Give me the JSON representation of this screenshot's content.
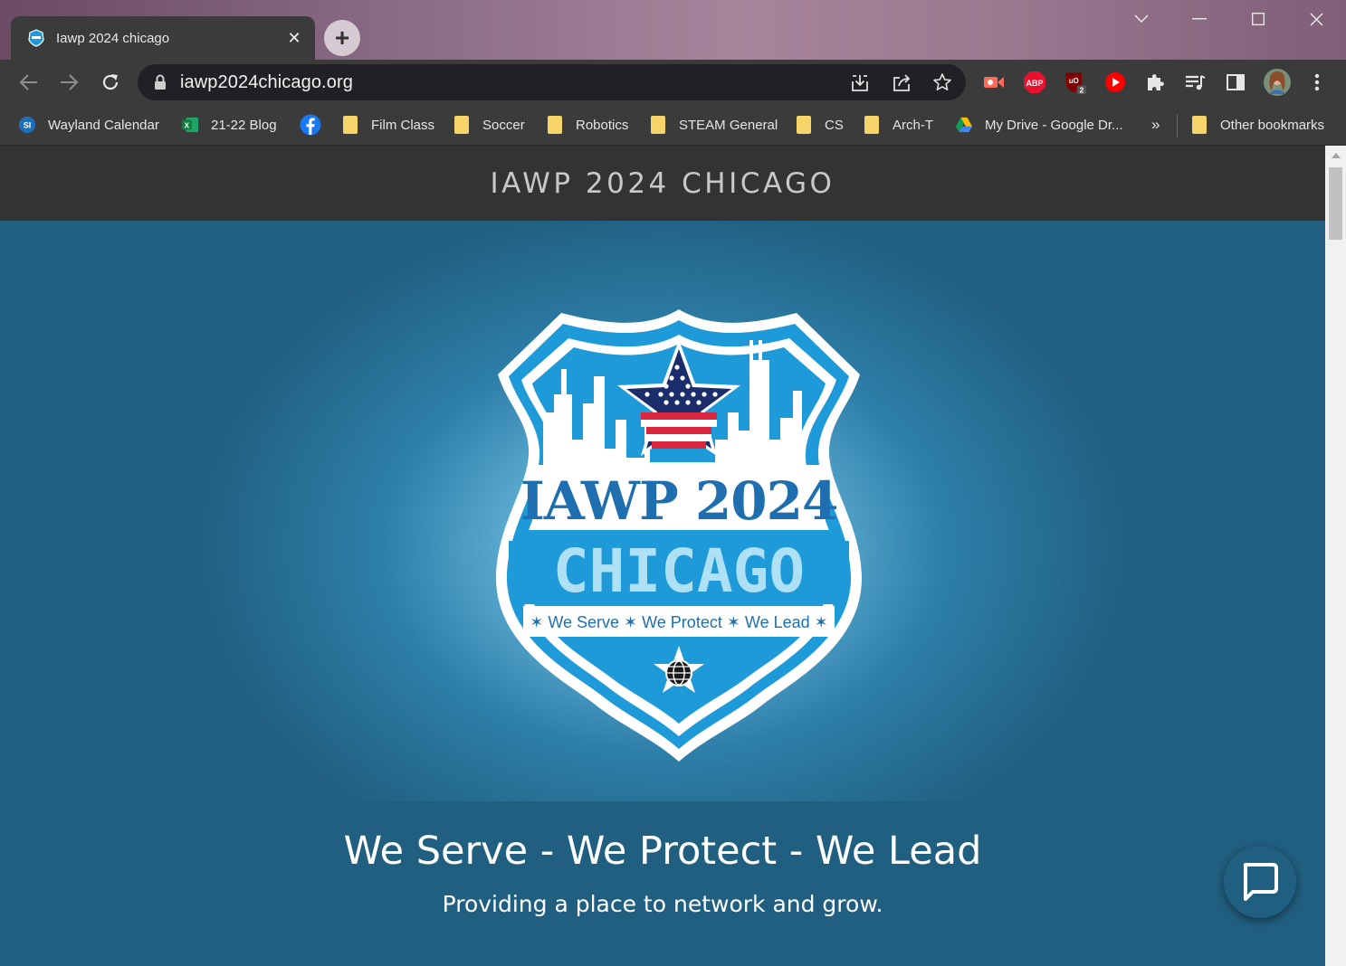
{
  "browser": {
    "tab": {
      "title": "Iawp 2024 chicago",
      "close_glyph": "✕"
    },
    "new_tab_glyph": "+",
    "window_controls": [
      "tab-search-icon",
      "minimize-icon",
      "maximize-icon",
      "close-icon"
    ],
    "address_bar": {
      "url": "iawp2024chicago.org"
    },
    "extensions": [
      {
        "name": "screencastify-icon",
        "color": "#ff5a4e"
      },
      {
        "name": "adblock-plus-icon",
        "label": "ABP",
        "color": "#e8112d"
      },
      {
        "name": "ublock-origin-icon",
        "label": "uO",
        "badge": "2",
        "color": "#800000"
      },
      {
        "name": "youtube-icon",
        "color": "#ff0000"
      },
      {
        "name": "extensions-puzzle-icon"
      },
      {
        "name": "reading-list-icon"
      },
      {
        "name": "side-panel-icon"
      },
      {
        "name": "profile-avatar"
      },
      {
        "name": "menu-kebab-icon"
      }
    ]
  },
  "bookmarks": {
    "items": [
      {
        "label": "Wayland Calendar",
        "icon": "wayland-si-icon"
      },
      {
        "label": "21-22 Blog",
        "icon": "excel-icon"
      },
      {
        "label": "",
        "icon": "facebook-icon"
      },
      {
        "label": "Film Class",
        "icon": "folder-icon"
      },
      {
        "label": "Soccer",
        "icon": "folder-icon"
      },
      {
        "label": "Robotics",
        "icon": "folder-icon"
      },
      {
        "label": "STEAM General",
        "icon": "folder-icon"
      },
      {
        "label": "CS",
        "icon": "folder-icon"
      },
      {
        "label": "Arch-T",
        "icon": "folder-icon"
      },
      {
        "label": "My Drive - Google Dr...",
        "icon": "google-drive-icon"
      }
    ],
    "overflow": "»",
    "other": "Other bookmarks"
  },
  "page": {
    "site_title": "IAWP 2024 CHICAGO",
    "logo": {
      "line1": "IAWP 2024",
      "line2": "CHICAGO",
      "motto": "✶ We Serve ✶ We Protect ✶ We Lead ✶"
    },
    "tagline": "We Serve - We Protect - We Lead",
    "subline": "Providing a place to network and grow.",
    "colors": {
      "header": "#333333",
      "background": "#215f80",
      "badge_blue": "#1f9ad8",
      "badge_light": "#aee0f6",
      "star_red": "#d7263d",
      "star_navy": "#1b2d6b"
    }
  }
}
